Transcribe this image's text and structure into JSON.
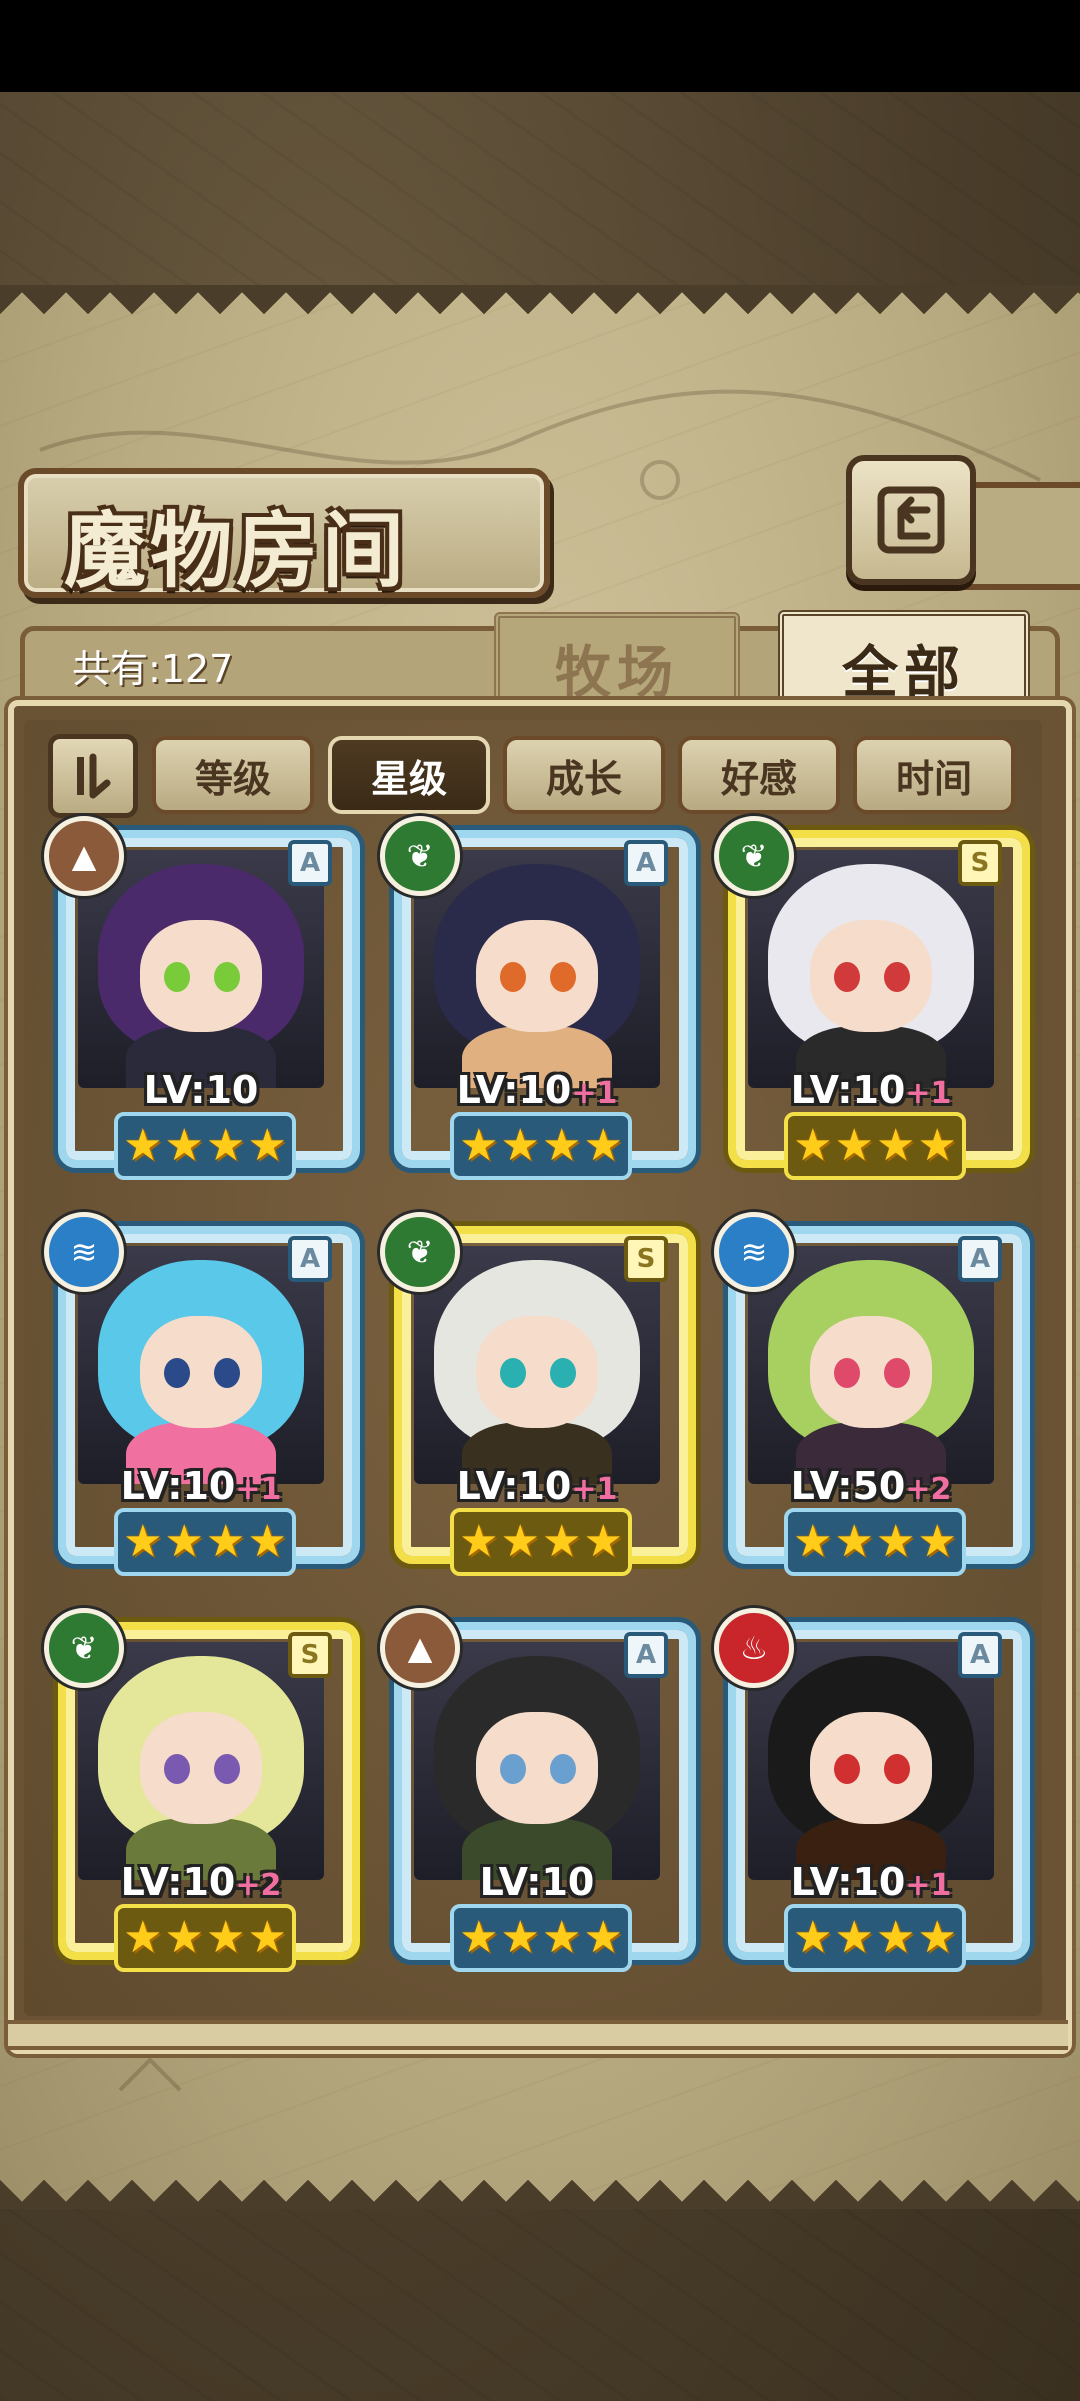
{
  "header": {
    "title": "魔物房间",
    "back_icon": "return-arrow-icon"
  },
  "summary": {
    "count_label": "共有:127"
  },
  "tabs": [
    {
      "label": "牧场",
      "active": false
    },
    {
      "label": "全部",
      "active": true
    }
  ],
  "sort": {
    "toggle_icon": "sort-order-icon",
    "buttons": [
      {
        "label": "等级",
        "active": false
      },
      {
        "label": "星级",
        "active": true
      },
      {
        "label": "成长",
        "active": false
      },
      {
        "label": "好感",
        "active": false
      },
      {
        "label": "时间",
        "active": false
      }
    ]
  },
  "monsters": [
    {
      "element": "earth",
      "element_icon": "mountain-icon",
      "rank": "A",
      "level": "LV:10",
      "plus": "",
      "stars": 4,
      "hair": "#4a2a6a",
      "body": "#2a2a3a",
      "eye": "#7acb3a"
    },
    {
      "element": "nature",
      "element_icon": "leaf-icon",
      "rank": "A",
      "level": "LV:10",
      "plus": "+1",
      "stars": 4,
      "hair": "#2a2a4a",
      "body": "#e0b080",
      "eye": "#e06a2a"
    },
    {
      "element": "nature",
      "element_icon": "leaf-icon",
      "rank": "S",
      "level": "LV:10",
      "plus": "+1",
      "stars": 4,
      "hair": "#e8e8ee",
      "body": "#2a2a2a",
      "eye": "#d03a3a"
    },
    {
      "element": "water",
      "element_icon": "wave-icon",
      "rank": "A",
      "level": "LV:10",
      "plus": "+1",
      "stars": 4,
      "hair": "#5ac8e8",
      "body": "#f070a0",
      "eye": "#2a4a8a"
    },
    {
      "element": "nature",
      "element_icon": "leaf-icon",
      "rank": "S",
      "level": "LV:10",
      "plus": "+1",
      "stars": 4,
      "hair": "#e6e6e0",
      "body": "#3a3020",
      "eye": "#2ab0b0"
    },
    {
      "element": "water",
      "element_icon": "wave-icon",
      "rank": "A",
      "level": "LV:50",
      "plus": "+2",
      "stars": 4,
      "hair": "#a8d060",
      "body": "#3a2a3a",
      "eye": "#e04a6a"
    },
    {
      "element": "nature",
      "element_icon": "leaf-icon",
      "rank": "S",
      "level": "LV:10",
      "plus": "+2",
      "stars": 4,
      "hair": "#e4e69a",
      "body": "#6a7a3a",
      "eye": "#7a5ab0"
    },
    {
      "element": "earth",
      "element_icon": "mountain-icon",
      "rank": "A",
      "level": "LV:10",
      "plus": "",
      "stars": 4,
      "hair": "#2a2a2a",
      "body": "#3a4a2a",
      "eye": "#6aa0d0"
    },
    {
      "element": "fire",
      "element_icon": "flame-icon",
      "rank": "A",
      "level": "LV:10",
      "plus": "+1",
      "stars": 4,
      "hair": "#1a1a1a",
      "body": "#3a2010",
      "eye": "#d03030"
    }
  ],
  "colors": {
    "frame_A": "#9fd7ef",
    "frame_S": "#f3df47",
    "star": "#ffcc1a",
    "plus_level": "#f06fa0"
  }
}
